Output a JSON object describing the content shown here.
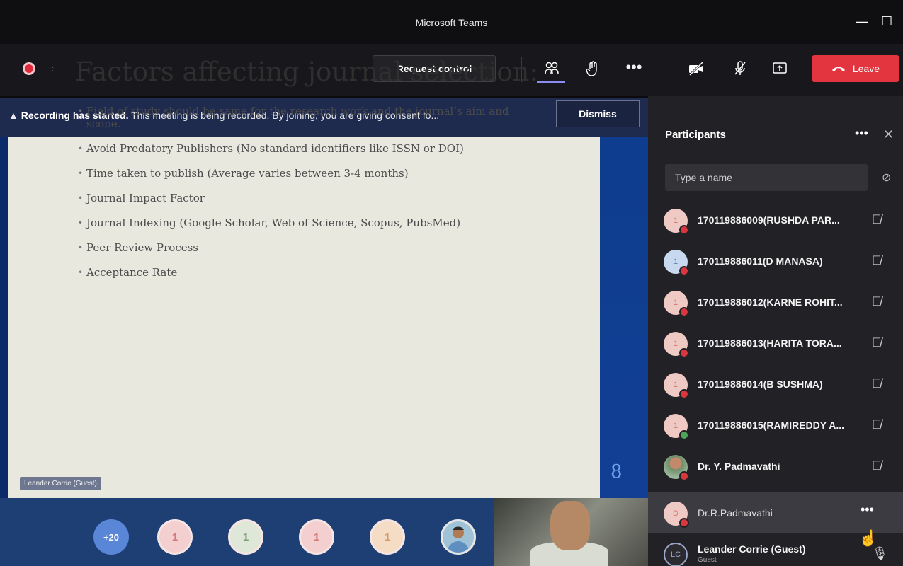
{
  "window": {
    "title": "Microsoft Teams",
    "minimize": "—",
    "maximize": "☐"
  },
  "toolbar": {
    "timer": "--:--",
    "request_control": "Request control",
    "leave_label": "Leave",
    "icons": [
      "participants-icon",
      "raise-hand-icon",
      "more-icon",
      "camera-off-icon",
      "mic-off-icon",
      "share-screen-icon",
      "phone-icon"
    ]
  },
  "banner": {
    "bold": "Recording has started.",
    "text": " This meeting is being recorded. By joining, you are giving consent fo...",
    "dismiss": "Dismiss"
  },
  "slide": {
    "title": "Factors affecting journal selection:",
    "bullets": [
      "Field of study should be same for the research work and the journal’s aim and scope.",
      "Avoid Predatory Publishers (No standard identifiers like ISSN or DOI)",
      "Time taken to publish (Average varies between 3-4 months)",
      "Journal Impact Factor",
      "Journal Indexing (Google Scholar, Web of Science, Scopus, PubsMed)",
      "Peer Review Process",
      "Acceptance Rate"
    ],
    "number": "8",
    "presenter": "Leander Corrie (Guest)"
  },
  "strip": {
    "more": "+20",
    "avatars": [
      "1",
      "1",
      "1",
      "1"
    ]
  },
  "panel": {
    "title": "Participants",
    "search_placeholder": "Type a name",
    "participants": [
      {
        "initial": "1",
        "name": "170119886009(RUSHDA PAR...",
        "status": "busy"
      },
      {
        "initial": "1",
        "name": "170119886011(D MANASA)",
        "status": "busy"
      },
      {
        "initial": "1",
        "name": "170119886012(KARNE ROHIT...",
        "status": "busy"
      },
      {
        "initial": "1",
        "name": "170119886013(HARITA TORA...",
        "status": "busy"
      },
      {
        "initial": "1",
        "name": "170119886014(B SUSHMA)",
        "status": "busy"
      },
      {
        "initial": "1",
        "name": "170119886015(RAMIREDDY A...",
        "status": "available"
      },
      {
        "initial": "",
        "name": "Dr. Y. Padmavathi",
        "status": "busy"
      },
      {
        "initial": "D",
        "name": "Dr.R.Padmavathi",
        "status": "busy"
      },
      {
        "initial": "LC",
        "name": "Leander Corrie (Guest)",
        "sub": "Guest",
        "status": ""
      }
    ]
  }
}
